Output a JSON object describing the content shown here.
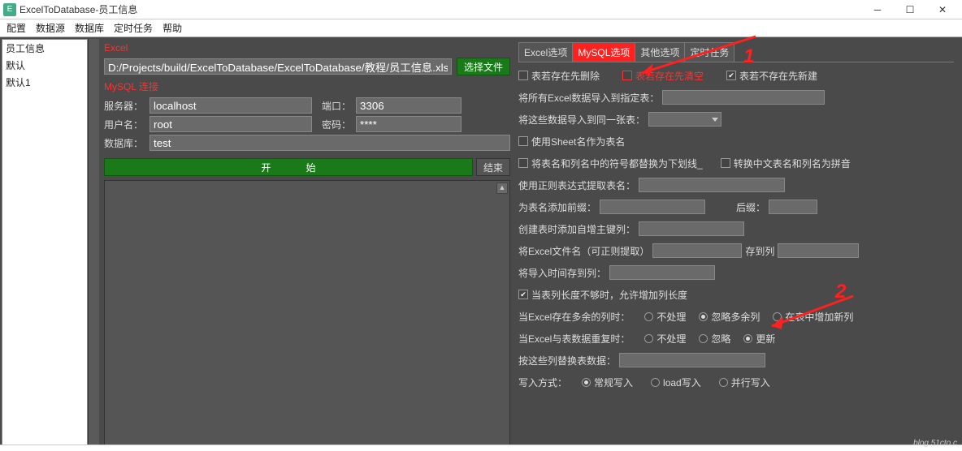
{
  "window": {
    "title": "ExcelToDatabase-员工信息"
  },
  "menu": [
    "配置",
    "数据源",
    "数据库",
    "定时任务",
    "帮助"
  ],
  "sidebar": {
    "items": [
      "员工信息",
      "默认",
      "默认1"
    ]
  },
  "excel": {
    "head": "Excel",
    "path": "D:/Projects/build/ExcelToDatabase/ExcelToDatabase/教程/员工信息.xlsx",
    "select_btn": "选择文件"
  },
  "mysql": {
    "head": "MySQL 连接",
    "server_lbl": "服务器：",
    "server": "localhost",
    "port_lbl": "端口：",
    "port": "3306",
    "user_lbl": "用户名：",
    "user": "root",
    "pwd_lbl": "密码：",
    "pwd": "****",
    "db_lbl": "数据库：",
    "db": "test"
  },
  "actions": {
    "start": "开    始",
    "end": "结束"
  },
  "tabs": [
    "Excel选项",
    "MySQL选项",
    "其他选项",
    "定时任务"
  ],
  "opts": {
    "del_if_exist": "表若存在先删除",
    "clear_if_exist": "表若存在先清空",
    "create_if_not": "表若不存在先新建",
    "import_to_table": "将所有Excel数据导入到指定表：",
    "import_same_table": "将这些数据导入到同一张表：",
    "use_sheet_name": "使用Sheet名作为表名",
    "replace_symbols": "将表名和列名中的符号都替换为下划线_",
    "convert_pinyin": "转换中文表名和列名为拼音",
    "regex_extract": "使用正则表达式提取表名：",
    "prefix_lbl": "为表名添加前缀：",
    "suffix_lbl": "后缀：",
    "auto_inc": "创建表时添加自增主键列：",
    "excel_filename": "将Excel文件名（可正则提取）",
    "store_to": "存到列",
    "import_time": "将导入时间存到列：",
    "allow_extend": "当表列长度不够时，允许增加列长度",
    "excel_extra_cols": "当Excel存在多余的列时：",
    "no_process": "不处理",
    "ignore_extra": "忽略多余列",
    "add_new_col": "在表中增加新列",
    "dup_data": "当Excel与表数据重复时：",
    "ignore": "忽略",
    "update": "更新",
    "replace_by_cols": "按这些列替换表数据：",
    "write_mode": "写入方式：",
    "normal_write": "常规写入",
    "load_write": "load写入",
    "parallel_write": "并行写入"
  },
  "annotations": {
    "a1": "1",
    "a2": "2"
  }
}
